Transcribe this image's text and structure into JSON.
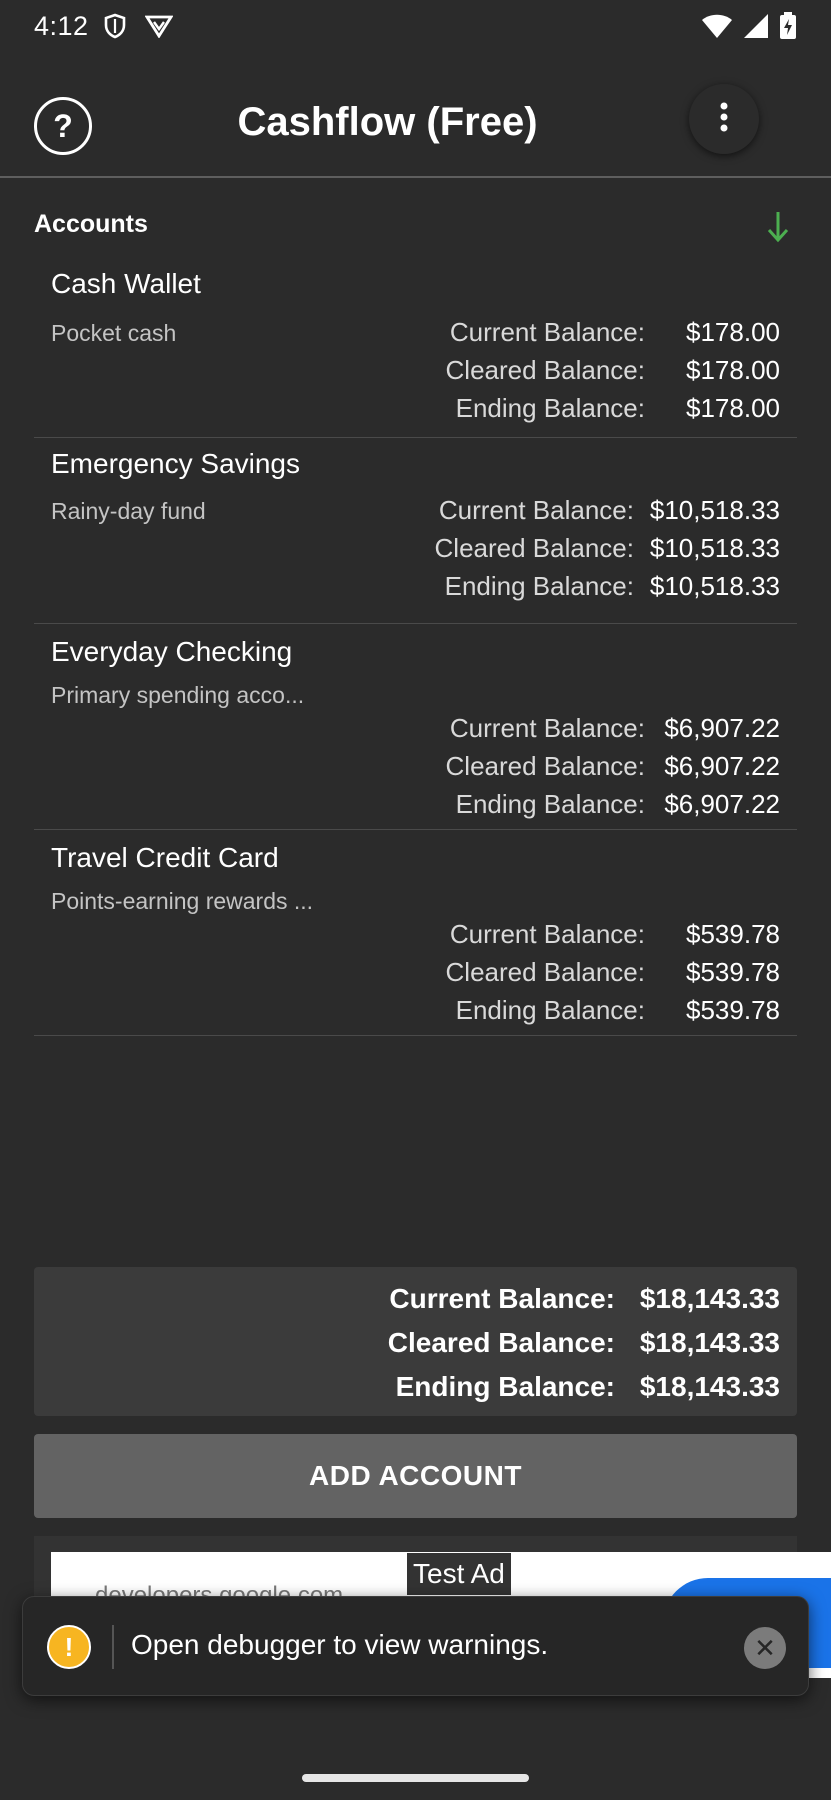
{
  "status_bar": {
    "time": "4:12",
    "icons": [
      "shield-icon",
      "vpn-icon"
    ],
    "right_icons": [
      "wifi-icon",
      "signal-icon",
      "battery-charging-icon"
    ]
  },
  "app_bar": {
    "help_symbol": "?",
    "title": "Cashflow (Free)",
    "menu_icon": "more-vert-icon"
  },
  "accounts_section": {
    "header": "Accounts",
    "sort_icon": "arrow-down-icon",
    "sort_icon_color": "#4caf50"
  },
  "labels": {
    "current": "Current Balance:",
    "cleared": "Cleared Balance:",
    "ending": "Ending Balance:"
  },
  "accounts": [
    {
      "name": "Cash Wallet",
      "description": "Pocket cash",
      "current": "$178.00",
      "cleared": "$178.00",
      "ending": "$178.00"
    },
    {
      "name": "Emergency Savings",
      "description": "Rainy-day fund",
      "current": "$10,518.33",
      "cleared": "$10,518.33",
      "ending": "$10,518.33"
    },
    {
      "name": "Everyday Checking",
      "description": "Primary spending acco...",
      "current": "$6,907.22",
      "cleared": "$6,907.22",
      "ending": "$6,907.22"
    },
    {
      "name": "Travel Credit Card",
      "description": "Points-earning rewards ...",
      "current": "$539.78",
      "cleared": "$539.78",
      "ending": "$539.78"
    }
  ],
  "totals": {
    "current": "$18,143.33",
    "cleared": "$18,143.33",
    "ending": "$18,143.33"
  },
  "add_account_label": "ADD ACCOUNT",
  "ad": {
    "tag": "Test Ad",
    "url": "developers.google.com"
  },
  "toast": {
    "warning_symbol": "!",
    "message": "Open debugger to view warnings.",
    "close_symbol": "✕"
  },
  "colors": {
    "background": "#2b2b2b",
    "totals_panel": "#3b3b3b",
    "button": "#636363",
    "warning": "#f7b521"
  }
}
